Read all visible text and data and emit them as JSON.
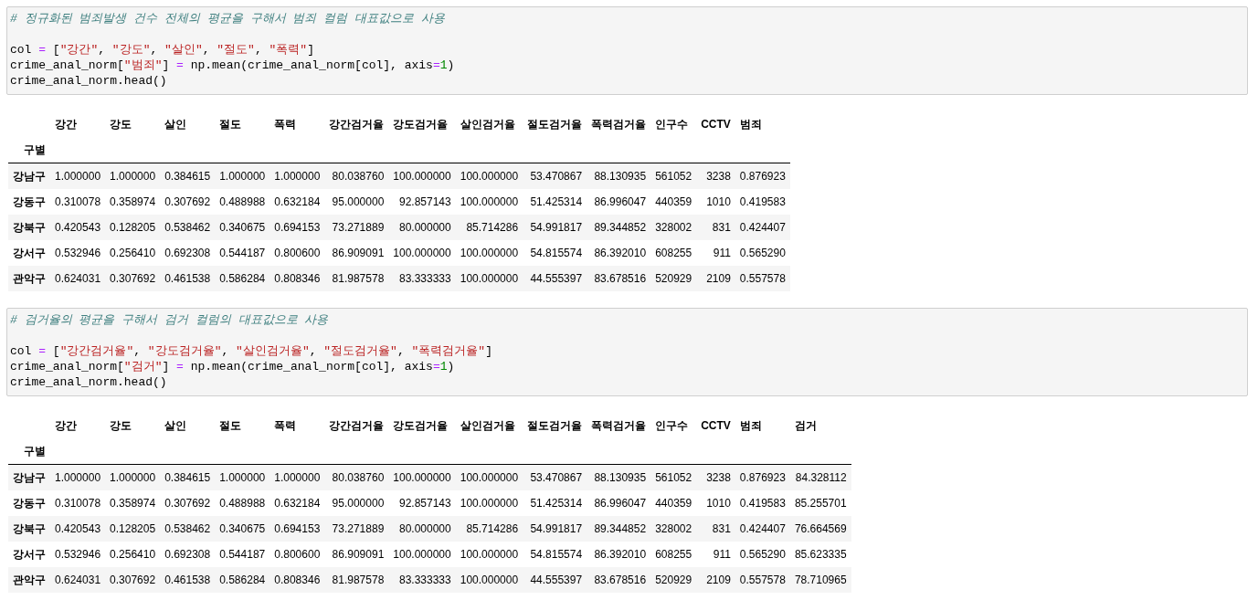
{
  "cells": [
    {
      "kind": "code",
      "lines": [
        [
          {
            "kind": "comment",
            "text": "# 정규화된 범죄발생 건수 전체의 평균을 구해서 범죄 컬럼 대표값으로 사용"
          }
        ],
        [
          {
            "kind": "plain",
            "text": "col "
          },
          {
            "kind": "op",
            "text": "="
          },
          {
            "kind": "plain",
            "text": " ["
          },
          {
            "kind": "str",
            "text": "\"강간\""
          },
          {
            "kind": "plain",
            "text": ", "
          },
          {
            "kind": "str",
            "text": "\"강도\""
          },
          {
            "kind": "plain",
            "text": ", "
          },
          {
            "kind": "str",
            "text": "\"살인\""
          },
          {
            "kind": "plain",
            "text": ", "
          },
          {
            "kind": "str",
            "text": "\"절도\""
          },
          {
            "kind": "plain",
            "text": ", "
          },
          {
            "kind": "str",
            "text": "\"폭력\""
          },
          {
            "kind": "plain",
            "text": "]"
          }
        ],
        [
          {
            "kind": "plain",
            "text": "crime_anal_norm["
          },
          {
            "kind": "str",
            "text": "\"범죄\""
          },
          {
            "kind": "plain",
            "text": "] "
          },
          {
            "kind": "op",
            "text": "="
          },
          {
            "kind": "plain",
            "text": " np.mean(crime_anal_norm[col], axis"
          },
          {
            "kind": "op",
            "text": "="
          },
          {
            "kind": "num",
            "text": "1"
          },
          {
            "kind": "plain",
            "text": ")"
          }
        ],
        [
          {
            "kind": "plain",
            "text": "crime_anal_norm.head()"
          }
        ]
      ]
    },
    {
      "kind": "table",
      "columns": [
        "강간",
        "강도",
        "살인",
        "절도",
        "폭력",
        "강간검거율",
        "강도검거율",
        "살인검거율",
        "절도검거율",
        "폭력검거율",
        "인구수",
        "CCTV",
        "범죄"
      ],
      "index_name": "구별",
      "rows": [
        {
          "index": "강남구",
          "values": [
            "1.000000",
            "1.000000",
            "0.384615",
            "1.000000",
            "1.000000",
            "80.038760",
            "100.000000",
            "100.000000",
            "53.470867",
            "88.130935",
            "561052",
            "3238",
            "0.876923"
          ]
        },
        {
          "index": "강동구",
          "values": [
            "0.310078",
            "0.358974",
            "0.307692",
            "0.488988",
            "0.632184",
            "95.000000",
            "92.857143",
            "100.000000",
            "51.425314",
            "86.996047",
            "440359",
            "1010",
            "0.419583"
          ]
        },
        {
          "index": "강북구",
          "values": [
            "0.420543",
            "0.128205",
            "0.538462",
            "0.340675",
            "0.694153",
            "73.271889",
            "80.000000",
            "85.714286",
            "54.991817",
            "89.344852",
            "328002",
            "831",
            "0.424407"
          ]
        },
        {
          "index": "강서구",
          "values": [
            "0.532946",
            "0.256410",
            "0.692308",
            "0.544187",
            "0.800600",
            "86.909091",
            "100.000000",
            "100.000000",
            "54.815574",
            "86.392010",
            "608255",
            "911",
            "0.565290"
          ]
        },
        {
          "index": "관악구",
          "values": [
            "0.624031",
            "0.307692",
            "0.461538",
            "0.586284",
            "0.808346",
            "81.987578",
            "83.333333",
            "100.000000",
            "44.555397",
            "83.678516",
            "520929",
            "2109",
            "0.557578"
          ]
        }
      ]
    },
    {
      "kind": "code",
      "lines": [
        [
          {
            "kind": "comment",
            "text": "# 검거율의 평균을 구해서 검거 컬럼의 대표값으로 사용"
          }
        ],
        [
          {
            "kind": "plain",
            "text": "col "
          },
          {
            "kind": "op",
            "text": "="
          },
          {
            "kind": "plain",
            "text": " ["
          },
          {
            "kind": "str",
            "text": "\"강간검거율\""
          },
          {
            "kind": "plain",
            "text": ", "
          },
          {
            "kind": "str",
            "text": "\"강도검거율\""
          },
          {
            "kind": "plain",
            "text": ", "
          },
          {
            "kind": "str",
            "text": "\"살인검거율\""
          },
          {
            "kind": "plain",
            "text": ", "
          },
          {
            "kind": "str",
            "text": "\"절도검거율\""
          },
          {
            "kind": "plain",
            "text": ", "
          },
          {
            "kind": "str",
            "text": "\"폭력검거율\""
          },
          {
            "kind": "plain",
            "text": "]"
          }
        ],
        [
          {
            "kind": "plain",
            "text": "crime_anal_norm["
          },
          {
            "kind": "str",
            "text": "\"검거\""
          },
          {
            "kind": "plain",
            "text": "] "
          },
          {
            "kind": "op",
            "text": "="
          },
          {
            "kind": "plain",
            "text": " np.mean(crime_anal_norm[col], axis"
          },
          {
            "kind": "op",
            "text": "="
          },
          {
            "kind": "num",
            "text": "1"
          },
          {
            "kind": "plain",
            "text": ")"
          }
        ],
        [
          {
            "kind": "plain",
            "text": "crime_anal_norm.head()"
          }
        ]
      ]
    },
    {
      "kind": "table",
      "columns": [
        "강간",
        "강도",
        "살인",
        "절도",
        "폭력",
        "강간검거율",
        "강도검거율",
        "살인검거율",
        "절도검거율",
        "폭력검거율",
        "인구수",
        "CCTV",
        "범죄",
        "검거"
      ],
      "index_name": "구별",
      "rows": [
        {
          "index": "강남구",
          "values": [
            "1.000000",
            "1.000000",
            "0.384615",
            "1.000000",
            "1.000000",
            "80.038760",
            "100.000000",
            "100.000000",
            "53.470867",
            "88.130935",
            "561052",
            "3238",
            "0.876923",
            "84.328112"
          ]
        },
        {
          "index": "강동구",
          "values": [
            "0.310078",
            "0.358974",
            "0.307692",
            "0.488988",
            "0.632184",
            "95.000000",
            "92.857143",
            "100.000000",
            "51.425314",
            "86.996047",
            "440359",
            "1010",
            "0.419583",
            "85.255701"
          ]
        },
        {
          "index": "강북구",
          "values": [
            "0.420543",
            "0.128205",
            "0.538462",
            "0.340675",
            "0.694153",
            "73.271889",
            "80.000000",
            "85.714286",
            "54.991817",
            "89.344852",
            "328002",
            "831",
            "0.424407",
            "76.664569"
          ]
        },
        {
          "index": "강서구",
          "values": [
            "0.532946",
            "0.256410",
            "0.692308",
            "0.544187",
            "0.800600",
            "86.909091",
            "100.000000",
            "100.000000",
            "54.815574",
            "86.392010",
            "608255",
            "911",
            "0.565290",
            "85.623335"
          ]
        },
        {
          "index": "관악구",
          "values": [
            "0.624031",
            "0.307692",
            "0.461538",
            "0.586284",
            "0.808346",
            "81.987578",
            "83.333333",
            "100.000000",
            "44.555397",
            "83.678516",
            "520929",
            "2109",
            "0.557578",
            "78.710965"
          ]
        }
      ]
    }
  ]
}
